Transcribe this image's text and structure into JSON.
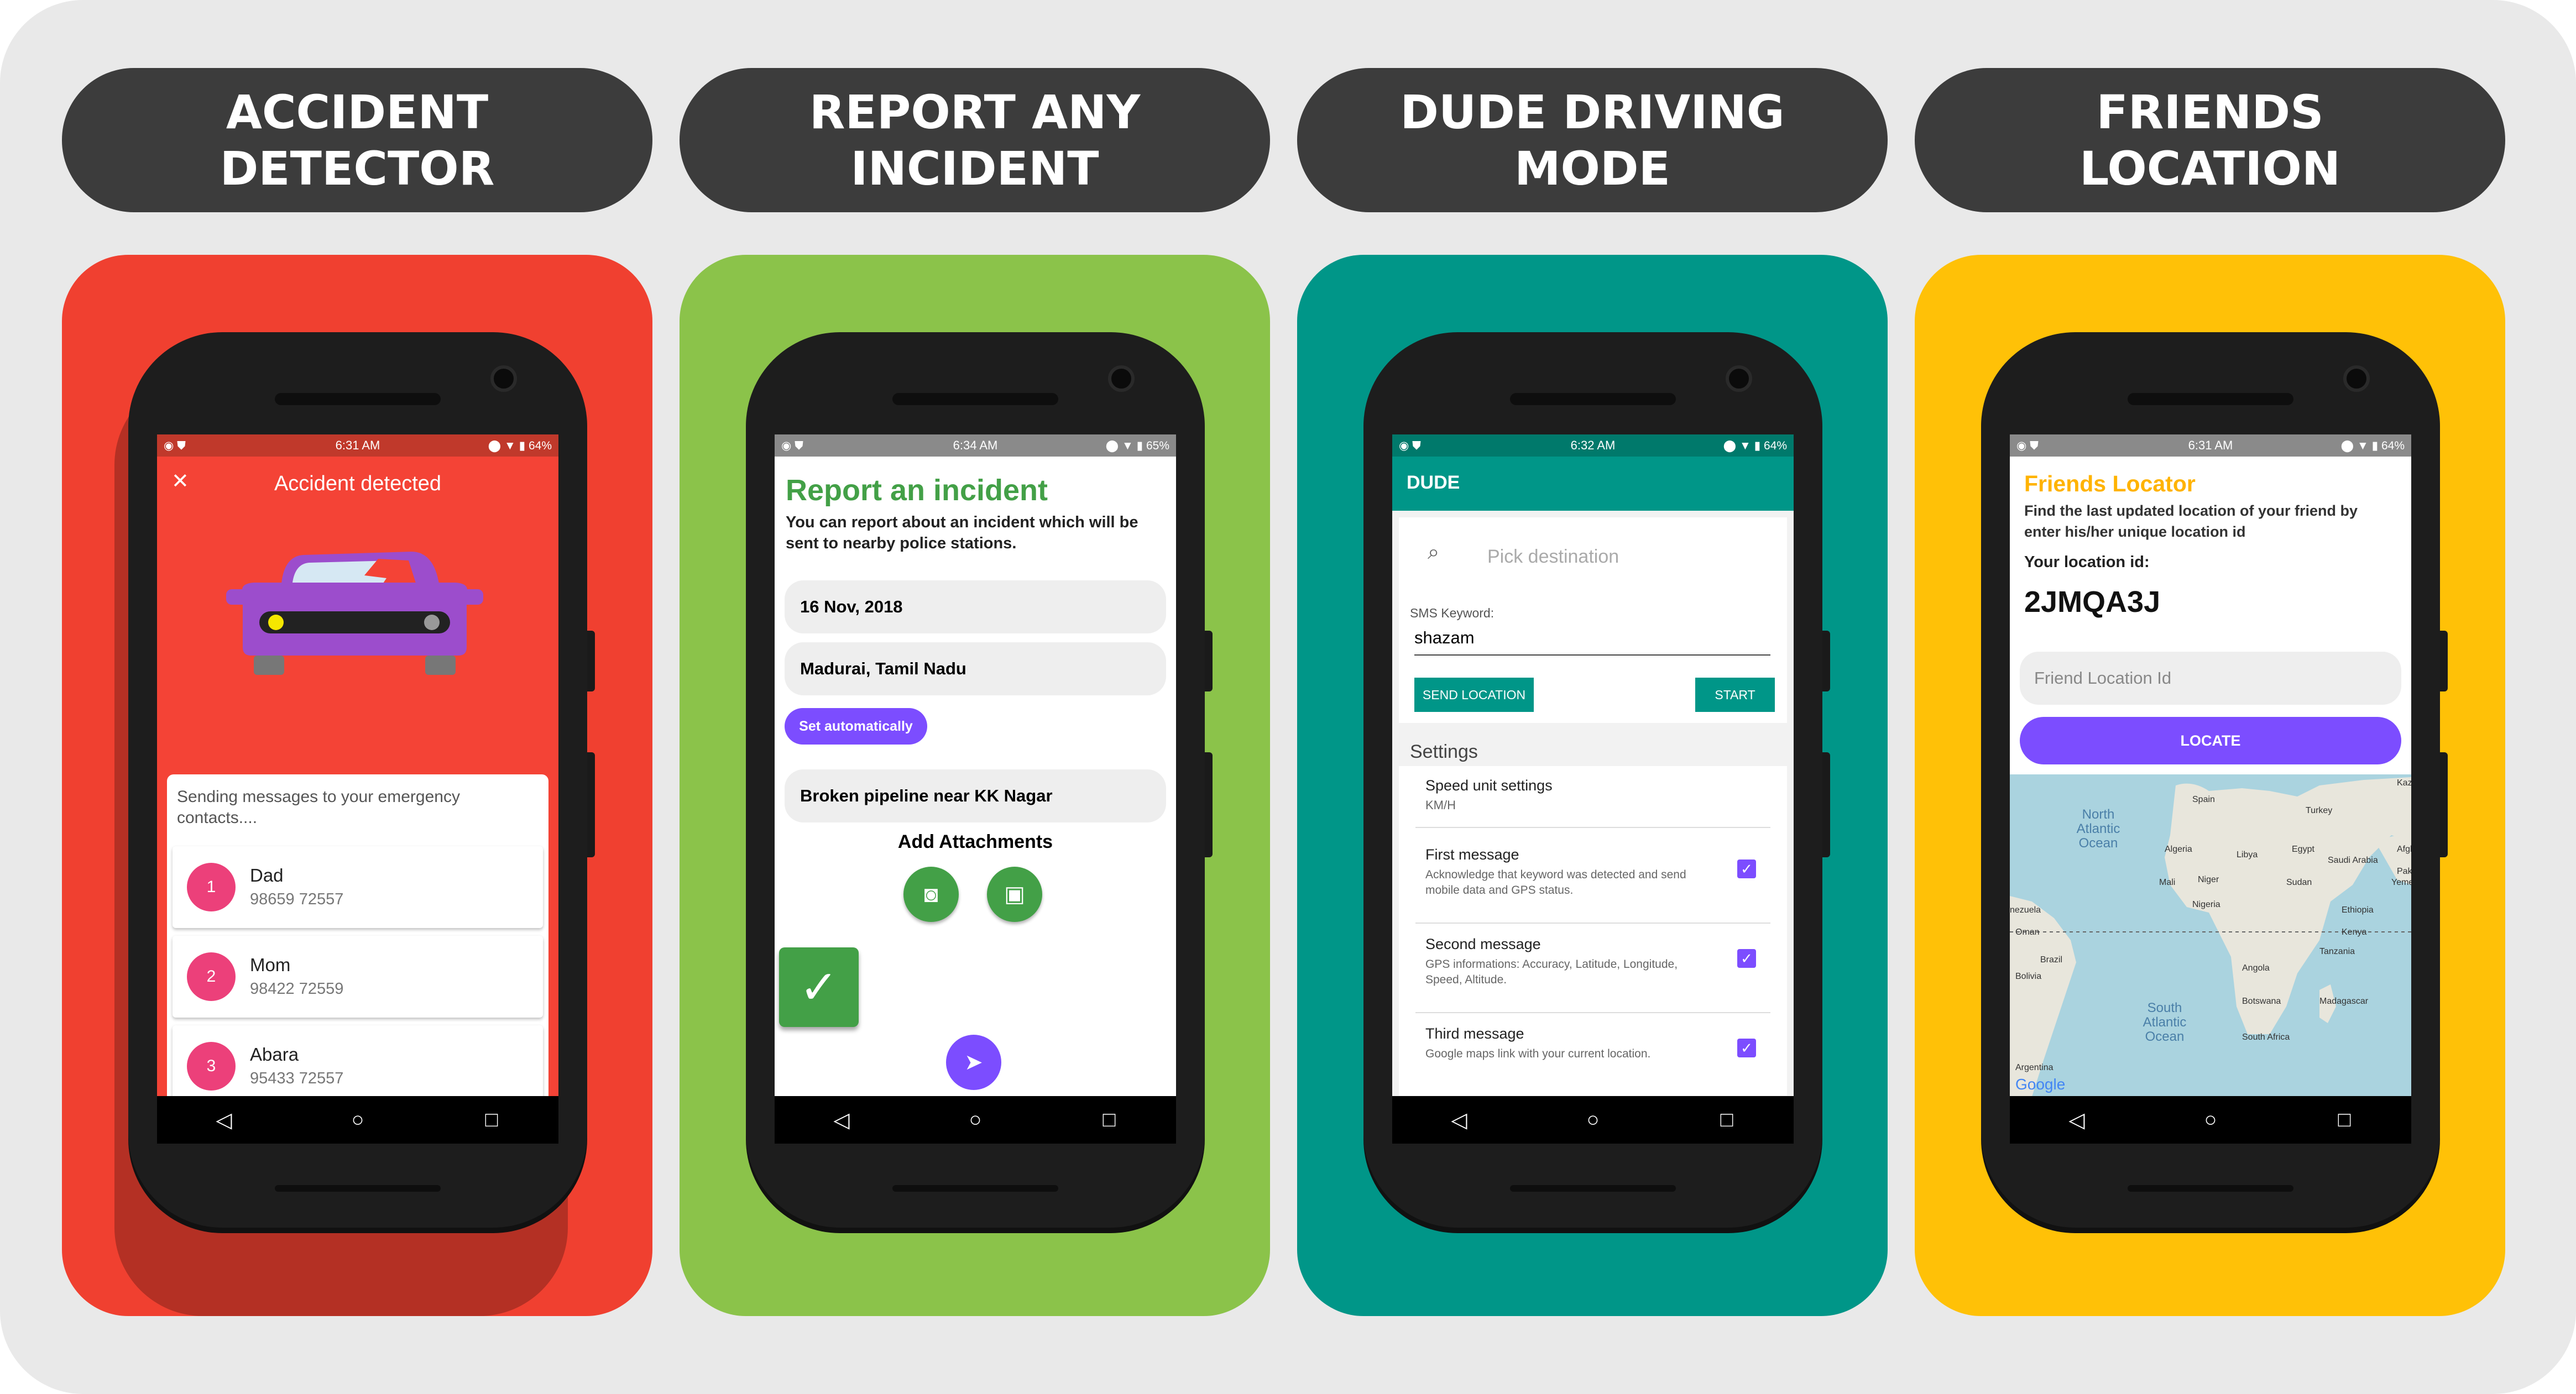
{
  "panels": [
    {
      "title": "ACCIDENT\nDETECTOR",
      "color": "#f04030"
    },
    {
      "title": "REPORT ANY\nINCIDENT",
      "color": "#8bc34a"
    },
    {
      "title": "DUDE DRIVING\nMODE",
      "color": "#009688"
    },
    {
      "title": "FRIENDS\nLOCATION",
      "color": "#ffc107"
    }
  ],
  "s1": {
    "time": "6:31 AM",
    "battery": "64%",
    "close_icon": "✕",
    "header": "Accident detected",
    "info": "Sending messages to your emergency contacts....",
    "contacts": [
      {
        "n": "1",
        "name": "Dad",
        "phone": "98659 72557"
      },
      {
        "n": "2",
        "name": "Mom",
        "phone": "98422 72559"
      },
      {
        "n": "3",
        "name": "Abara",
        "phone": "95433 72557"
      }
    ]
  },
  "s2": {
    "time": "6:34 AM",
    "battery": "65%",
    "title": "Report an incident",
    "subtitle": "You can report about an incident which will be sent to nearby police stations.",
    "date": "16 Nov, 2018",
    "place": "Madurai, Tamil Nadu",
    "auto_btn": "Set automatically",
    "desc": "Broken pipeline near KK Nagar",
    "attach": "Add Attachments"
  },
  "s3": {
    "time": "6:32 AM",
    "battery": "64%",
    "appbar": "DUDE",
    "dest_placeholder": "Pick destination",
    "kw_label": "SMS Keyword:",
    "kw_value": "shazam",
    "send_btn": "SEND LOCATION",
    "start_btn": "START",
    "settings": "Settings",
    "speed_title": "Speed unit settings",
    "speed_value": "KM/H",
    "items": [
      {
        "t": "First message",
        "d": "Acknowledge that keyword was detected and send mobile data and GPS status."
      },
      {
        "t": "Second message",
        "d": "GPS informations: Accuracy, Latitude, Longitude, Speed, Altitude."
      },
      {
        "t": "Third message",
        "d": "Google maps link with your current location."
      }
    ]
  },
  "s4": {
    "time": "6:31 AM",
    "battery": "64%",
    "title": "Friends Locator",
    "subtitle": "Find the last updated location of your friend by enter his/her unique location id",
    "your_id_label": "Your location id:",
    "your_id": "2JMQA3J",
    "input_placeholder": "Friend Location Id",
    "locate_btn": "LOCATE",
    "map_labels": [
      "Kazakh",
      "Spain",
      "Turkey",
      "Algeria",
      "Libya",
      "Egypt",
      "Saudi Arabia",
      "Mali",
      "Niger",
      "Sudan",
      "Nigeria",
      "Ethiopia",
      "Kenya",
      "Tanzania",
      "Angola",
      "Botswana",
      "Madagascar",
      "South Africa",
      "Brazil",
      "Bolivia",
      "Argentina",
      "nezuela",
      "Yemen",
      "North Atlantic Ocean",
      "South Atlantic Ocean",
      "Google",
      "Afghanis",
      "Pakistan",
      "Oman"
    ]
  }
}
